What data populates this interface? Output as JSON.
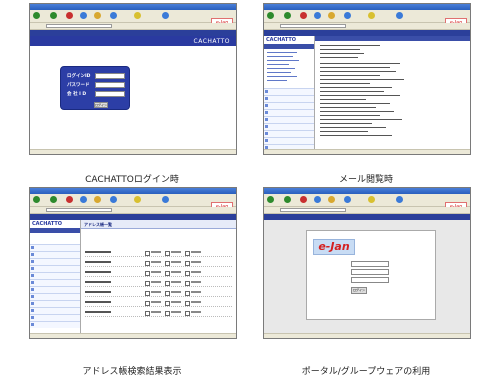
{
  "captions": {
    "login": "CACHATTOログイン時",
    "mail": "メール閲覧時",
    "address": "アドレス帳検索結果表示",
    "portal": "ポータル/グループウェアの利用"
  },
  "brand": {
    "name": "CACHATTO"
  },
  "login": {
    "id_label": "ログインID",
    "password_label": "パスワード",
    "company_label": "会 社 I D",
    "submit_label": "ログイン"
  },
  "address": {
    "title": "アドレス帳一覧"
  },
  "portal": {
    "logo": "e-Jan",
    "login_button": "ログイン"
  },
  "ejan_logo": "e-Jan"
}
